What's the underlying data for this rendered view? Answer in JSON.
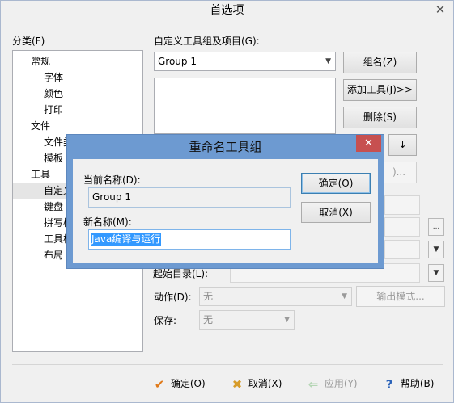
{
  "prefs": {
    "title": "首选项",
    "close": "✕",
    "category_label": "分类(F)",
    "tree": [
      {
        "label": "常规",
        "level": 0
      },
      {
        "label": "字体",
        "level": 1
      },
      {
        "label": "颜色",
        "level": 1
      },
      {
        "label": "打印",
        "level": 1
      },
      {
        "label": "文件",
        "level": 0
      },
      {
        "label": "文件类",
        "level": 1
      },
      {
        "label": "模板",
        "level": 1
      },
      {
        "label": "工具",
        "level": 0
      },
      {
        "label": "自定义",
        "level": 1,
        "selected": true
      },
      {
        "label": "键盘",
        "level": 1
      },
      {
        "label": "拼写检",
        "level": 1
      },
      {
        "label": "工具栏",
        "level": 1
      },
      {
        "label": "布局",
        "level": 1
      }
    ],
    "groups_label": "自定义工具组及项目(G):",
    "group_select": "Group 1",
    "group_name_btn": "组名(Z)",
    "add_tool_btn": "添加工具(J)>>",
    "delete_btn": "删除(S)",
    "down_btn": "↓",
    "partial_btn": ")...",
    "start_dir_label": "起始目录(L):",
    "action_label": "动作(D):",
    "action_value": "无",
    "output_mode_btn": "输出模式...",
    "save_label": "保存:",
    "save_value": "无",
    "ellipsis_btn": "...",
    "ok": "确定(O)",
    "cancel": "取消(X)",
    "apply": "应用(Y)",
    "help": "帮助(B)"
  },
  "rename": {
    "title": "重命名工具组",
    "close": "✕",
    "current_label": "当前名称(D):",
    "current_value": "Group 1",
    "new_label": "新名称(M):",
    "new_value": "Java编译与运行",
    "ok": "确定(O)",
    "cancel": "取消(X)"
  }
}
